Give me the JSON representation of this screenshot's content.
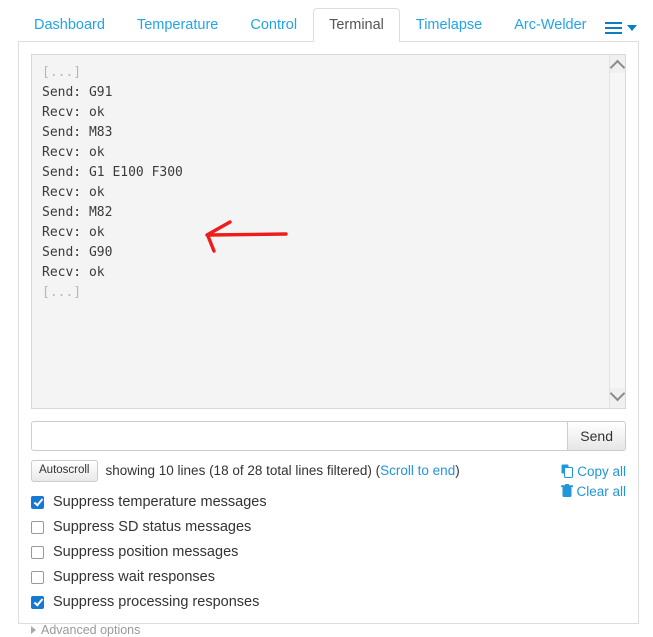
{
  "tabs": [
    {
      "label": "Dashboard",
      "active": false
    },
    {
      "label": "Temperature",
      "active": false
    },
    {
      "label": "Control",
      "active": false
    },
    {
      "label": "Terminal",
      "active": true
    },
    {
      "label": "Timelapse",
      "active": false
    },
    {
      "label": "Arc-Welder",
      "active": false
    }
  ],
  "menu": {
    "icon": "hamburger-icon",
    "caret": "caret-down-icon"
  },
  "terminal": {
    "lines": [
      {
        "text": "[...]",
        "muted": true
      },
      {
        "text": "Send: G91",
        "muted": false
      },
      {
        "text": "Recv: ok",
        "muted": false
      },
      {
        "text": "Send: M83",
        "muted": false
      },
      {
        "text": "Recv: ok",
        "muted": false
      },
      {
        "text": "Send: G1 E100 F300",
        "muted": false
      },
      {
        "text": "Recv: ok",
        "muted": false
      },
      {
        "text": "Send: M82",
        "muted": false
      },
      {
        "text": "Recv: ok",
        "muted": false
      },
      {
        "text": "Send: G90",
        "muted": false
      },
      {
        "text": "Recv: ok",
        "muted": false
      },
      {
        "text": "[...]",
        "muted": true
      }
    ],
    "annotation_color": "#ee1c1c"
  },
  "send": {
    "input_value": "",
    "placeholder": "",
    "button_label": "Send"
  },
  "status": {
    "autoscroll_label": "Autoscroll",
    "text": "showing 10 lines (18 of 28 total lines filtered) (",
    "scroll_to_end_label": "Scroll to end",
    "text_end": ")"
  },
  "actions": [
    {
      "label": "Copy all",
      "icon": "copy-icon"
    },
    {
      "label": "Clear all",
      "icon": "trash-icon"
    }
  ],
  "filters": [
    {
      "label": "Suppress temperature messages",
      "checked": true
    },
    {
      "label": "Suppress SD status messages",
      "checked": false
    },
    {
      "label": "Suppress position messages",
      "checked": false
    },
    {
      "label": "Suppress wait responses",
      "checked": false
    },
    {
      "label": "Suppress processing responses",
      "checked": true
    }
  ],
  "advanced": {
    "label": "Advanced options"
  },
  "colors": {
    "link": "#2196d8",
    "tab_link": "#23a3e8",
    "checkbox_checked": "#1478d4",
    "annotation": "#ee1c1c"
  }
}
